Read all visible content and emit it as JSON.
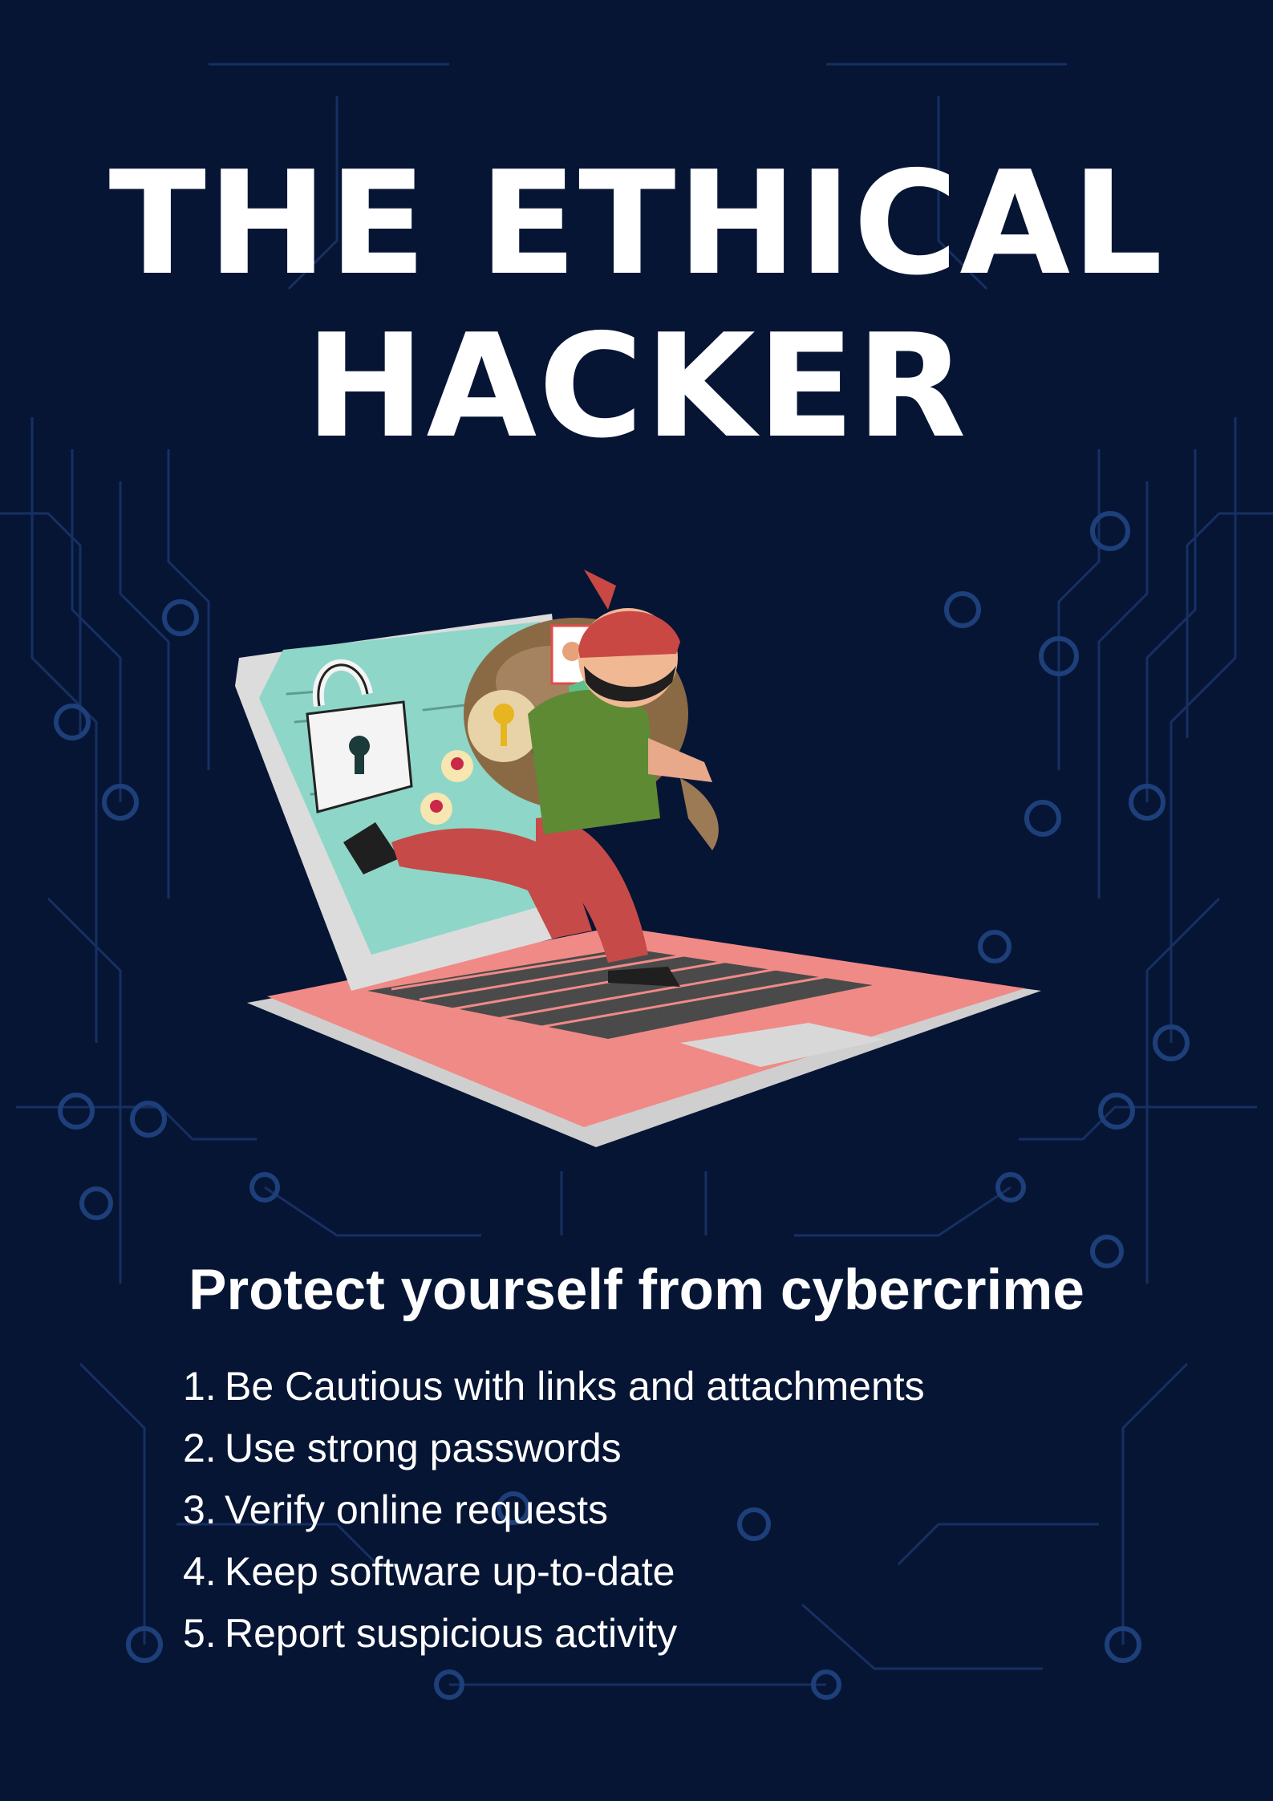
{
  "title_line1": "THE ETHICAL",
  "title_line2": "HACKER",
  "subtitle": "Protect yourself from cybercrime",
  "tips": [
    {
      "num": "1.",
      "text": "Be Cautious with links and attachments"
    },
    {
      "num": "2.",
      "text": "Use strong passwords"
    },
    {
      "num": "3.",
      "text": "Verify online requests"
    },
    {
      "num": "4.",
      "text": "Keep software up-to-date"
    },
    {
      "num": "5.",
      "text": "Report suspicious activity"
    }
  ],
  "illustration": {
    "password_mask": "****",
    "icons": [
      "open-padlock-icon",
      "key-icon",
      "coin-icon",
      "id-card-icon",
      "shield-icon",
      "loot-bag-icon"
    ]
  },
  "colors": {
    "background": "#071535",
    "circuit": "#173466",
    "text": "#ffffff",
    "screen": "#8ed6c8",
    "keyboard_deck": "#f08a87",
    "laptop_frame": "#d4d4d4"
  }
}
